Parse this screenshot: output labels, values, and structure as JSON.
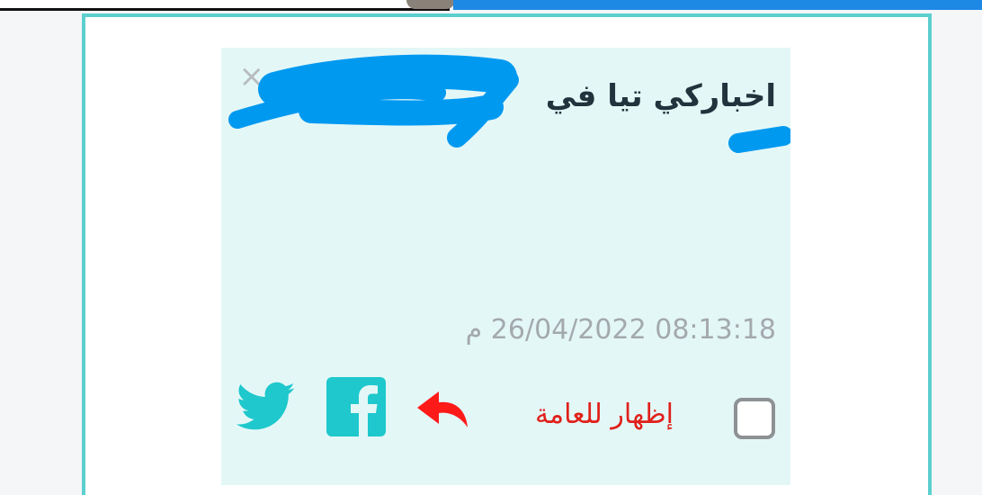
{
  "card": {
    "close_icon": "close-icon",
    "title": "اخباركي تيا في",
    "timestamp": "08:13:18 26/04/2022 م",
    "public_label": "إظهار للعامة",
    "share_icons": [
      "facebook-icon",
      "twitter-icon"
    ],
    "colors": {
      "frame": "#5ccfcf",
      "card_bg": "#e4f7f7",
      "social": "#1ec8cc",
      "annotation": "#ff0000",
      "redaction": "#0099f0"
    }
  }
}
